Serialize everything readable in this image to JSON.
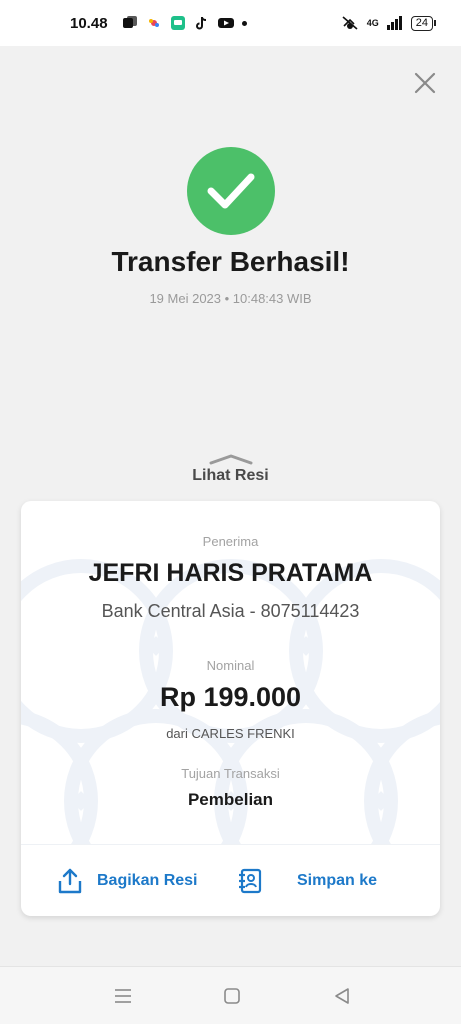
{
  "status_bar": {
    "time": "10.48",
    "network": "4G",
    "battery": "24"
  },
  "header": {
    "close_icon": "close-icon"
  },
  "success": {
    "icon": "checkmark-icon",
    "color": "#4cc069",
    "title": "Transfer Berhasil!",
    "timestamp": "19 Mei 2023 • 10:48:43 WIB"
  },
  "receipt_toggle": {
    "label": "Lihat Resi",
    "icon": "chevron-up-icon"
  },
  "receipt": {
    "recipient_label": "Penerima",
    "recipient_name": "JEFRI HARIS PRATAMA",
    "bank_info": "Bank Central Asia - 8075114423",
    "nominal_label": "Nominal",
    "amount": "Rp 199.000",
    "sender": "dari CARLES FRENKI",
    "purpose_label": "Tujuan Transaksi",
    "purpose": "Pembelian"
  },
  "actions": {
    "share_label": "Bagikan Resi",
    "share_icon": "share-icon",
    "save_label": "Simpan ke",
    "save_icon": "save-contact-icon",
    "accent_color": "#1d79c9"
  },
  "nav_bar": {
    "menu_icon": "recent-apps-icon",
    "home_icon": "home-icon",
    "back_icon": "back-icon"
  }
}
